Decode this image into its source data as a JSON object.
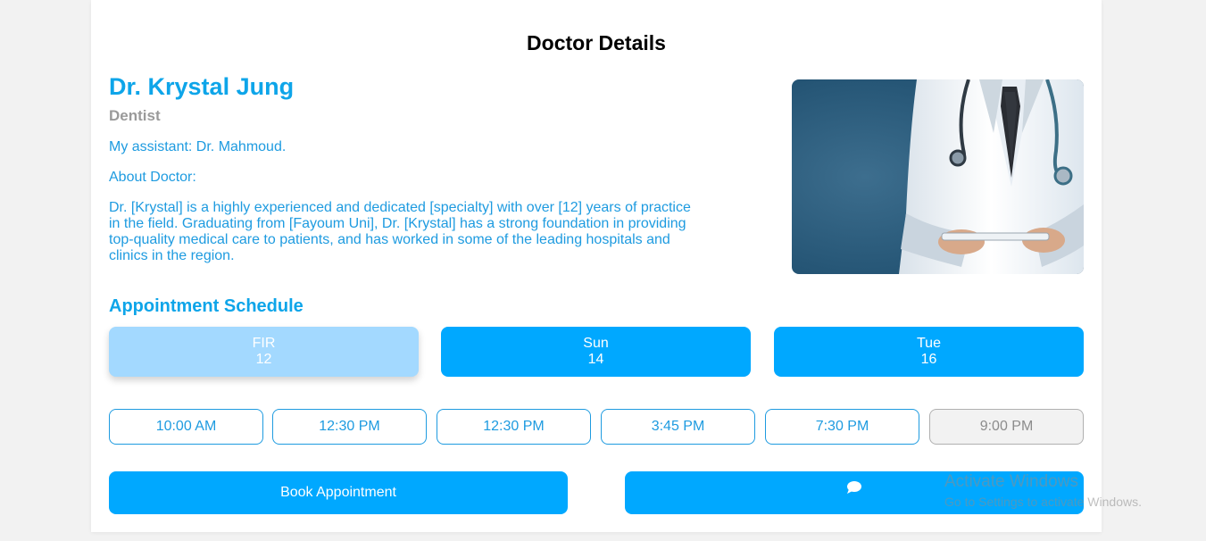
{
  "page": {
    "title": "Doctor Details"
  },
  "doctor": {
    "name": "Dr. Krystal Jung",
    "specialty": "Dentist",
    "assistant": "My assistant: Dr. Mahmoud.",
    "about_label": "About Doctor:",
    "about_text": "Dr. [Krystal] is a highly experienced and dedicated [specialty] with over [12] years of practice in the field. Graduating from [Fayoum Uni], Dr. [Krystal] has a strong foundation in providing top-quality medical care to patients, and has worked in some of the leading hospitals and clinics in the region."
  },
  "schedule": {
    "title": "Appointment Schedule",
    "days": [
      {
        "day": "FIR",
        "date": "12",
        "selected": true
      },
      {
        "day": "Sun",
        "date": "14",
        "selected": false
      },
      {
        "day": "Tue",
        "date": "16",
        "selected": false
      }
    ],
    "times": [
      {
        "label": "10:00 AM",
        "available": true
      },
      {
        "label": "12:30 PM",
        "available": true
      },
      {
        "label": "12:30 PM",
        "available": true
      },
      {
        "label": "3:45 PM",
        "available": true
      },
      {
        "label": "7:30 PM",
        "available": true
      },
      {
        "label": "9:00 PM",
        "available": false
      }
    ]
  },
  "actions": {
    "book_label": "Book Appointment",
    "chat_icon": "chat-bubble-icon"
  },
  "watermark": {
    "title": "Activate Windows",
    "subtitle": "Go to Settings to activate Windows."
  },
  "colors": {
    "accent": "#00a8ff",
    "text_blue": "#1e9be0",
    "selected_day": "#a3d9ff",
    "muted": "#9a9a9a"
  }
}
